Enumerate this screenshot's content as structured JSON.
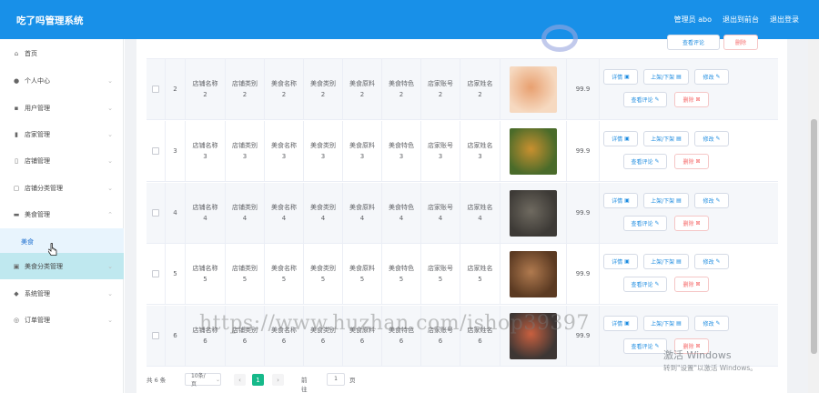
{
  "app": {
    "title": "吃了吗管理系统",
    "admin": "管理员 abo",
    "to_front": "退出到前台",
    "logout": "退出登录"
  },
  "sidebar": [
    {
      "label": "首页",
      "icon": "home-icon",
      "glyph": "⌂",
      "chev": ""
    },
    {
      "label": "个人中心",
      "icon": "user-icon",
      "glyph": "●",
      "chev": "⌄"
    },
    {
      "label": "用户管理",
      "icon": "user-manage-icon",
      "glyph": "▪",
      "chev": "⌄"
    },
    {
      "label": "店家管理",
      "icon": "chart-icon",
      "glyph": "▮",
      "chev": "⌄"
    },
    {
      "label": "店铺管理",
      "icon": "shop-icon",
      "glyph": "▯",
      "chev": "⌄"
    },
    {
      "label": "店铺分类管理",
      "icon": "message-icon",
      "glyph": "▢",
      "chev": "⌄"
    },
    {
      "label": "美食管理",
      "icon": "food-icon",
      "glyph": "▬",
      "chev": "⌃"
    },
    {
      "label": "美食",
      "icon": "",
      "glyph": "",
      "chev": ""
    },
    {
      "label": "美食分类管理",
      "icon": "category-icon",
      "glyph": "▣",
      "chev": "⌄"
    },
    {
      "label": "系统管理",
      "icon": "system-icon",
      "glyph": "◆",
      "chev": "⌄"
    },
    {
      "label": "订单管理",
      "icon": "order-icon",
      "glyph": "◎",
      "chev": "⌄"
    }
  ],
  "row_top_buttons": [
    "查看评论",
    "删除"
  ],
  "rows": [
    {
      "n": "2",
      "c": [
        "店铺名称\n2",
        "店铺类别\n2",
        "美食名称\n2",
        "美食类别\n2",
        "美食原料\n2",
        "美食特色\n2",
        "店家账号\n2",
        "店家姓名\n2"
      ],
      "price": "99.9",
      "alt": true
    },
    {
      "n": "3",
      "c": [
        "店铺名称\n3",
        "店铺类别\n3",
        "美食名称\n3",
        "美食类别\n3",
        "美食原料\n3",
        "美食特色\n3",
        "店家账号\n3",
        "店家姓名\n3"
      ],
      "price": "99.9",
      "alt": false
    },
    {
      "n": "4",
      "c": [
        "店铺名称\n4",
        "店铺类别\n4",
        "美食名称\n4",
        "美食类别\n4",
        "美食原料\n4",
        "美食特色\n4",
        "店家账号\n4",
        "店家姓名\n4"
      ],
      "price": "99.9",
      "alt": true
    },
    {
      "n": "5",
      "c": [
        "店铺名称\n5",
        "店铺类别\n5",
        "美食名称\n5",
        "美食类别\n5",
        "美食原料\n5",
        "美食特色\n5",
        "店家账号\n5",
        "店家姓名\n5"
      ],
      "price": "99.9",
      "alt": false
    },
    {
      "n": "6",
      "c": [
        "店铺名称\n6",
        "店铺类别\n6",
        "美食名称\n6",
        "美食类别\n6",
        "美食原料\n6",
        "美食特色\n6",
        "店家账号\n6",
        "店家姓名\n6"
      ],
      "price": "99.9",
      "alt": true
    }
  ],
  "buttons": {
    "detail": "详情",
    "upload": "上架/下架",
    "edit": "修改",
    "comment": "查看评论",
    "delete": "删除"
  },
  "food_colors": [
    [
      "#e8a070",
      "#f6d9c0"
    ],
    [
      "#c9902f",
      "#4a6b2a"
    ],
    [
      "#6f6a60",
      "#3d3a36"
    ],
    [
      "#b07a4f",
      "#5b3a22"
    ],
    [
      "#c9603f",
      "#3d3634"
    ]
  ],
  "pager": {
    "total": "共 6 条",
    "size": "10条/页",
    "page": "1",
    "goto": "前往",
    "goto_value": "1",
    "unit": "页"
  },
  "watermark": "https://www.huzhan.com/ishop39397",
  "windows": {
    "line1": "激活 Windows",
    "line2": "转到\"设置\"以激活 Windows。"
  }
}
